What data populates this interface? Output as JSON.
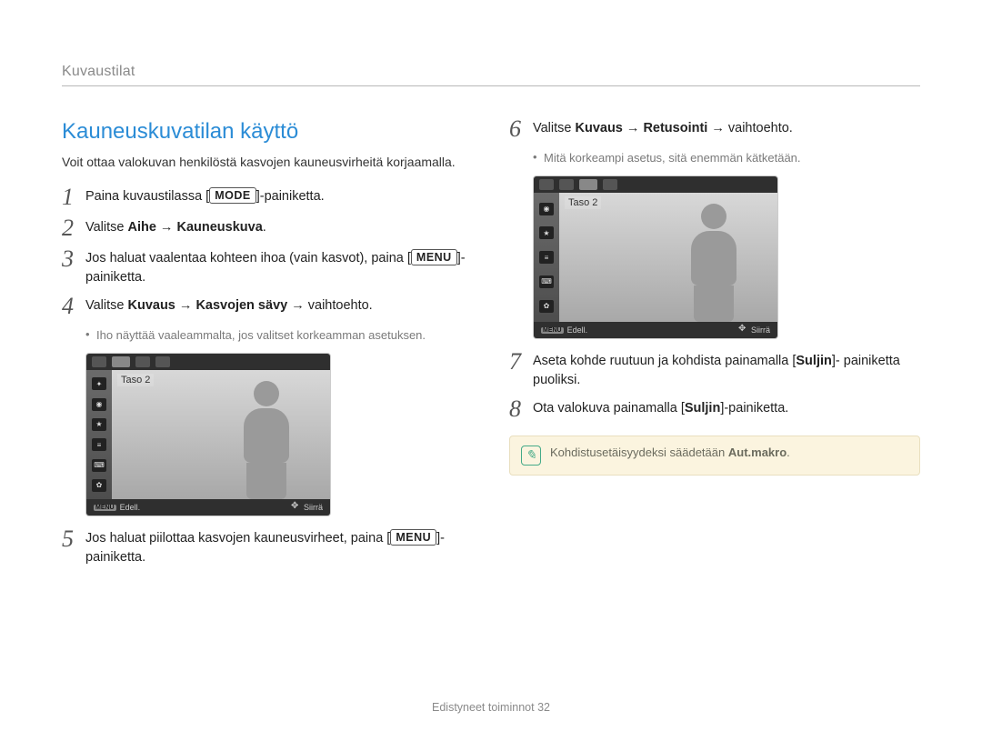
{
  "header": {
    "section": "Kuvaustilat"
  },
  "title": "Kauneuskuvatilan käyttö",
  "intro": "Voit ottaa valokuvan henkilöstä kasvojen kauneusvirheitä korjaamalla.",
  "buttons": {
    "mode": "MODE",
    "menu": "MENU"
  },
  "steps": {
    "s1_pre": "Paina kuvaustilassa [",
    "s1_post": "]-painiketta.",
    "s2_pre": "Valitse ",
    "s2_b1": "Aihe",
    "s2_arrow": " → ",
    "s2_b2": "Kauneuskuva",
    "s2_post": ".",
    "s3_pre": "Jos haluat vaalentaa kohteen ihoa (vain kasvot), paina [",
    "s3_post": "]-painiketta.",
    "s4_pre": "Valitse ",
    "s4_b1": "Kuvaus",
    "s4_mid1": " → ",
    "s4_b2": "Kasvojen sävy",
    "s4_mid2": " → vaihtoehto.",
    "s4_sub": "Iho näyttää vaaleammalta, jos valitset korkeamman asetuksen.",
    "s5_pre": "Jos haluat piilottaa kasvojen kauneusvirheet, paina [",
    "s5_post": "]-painiketta.",
    "s6_pre": "Valitse ",
    "s6_b1": "Kuvaus",
    "s6_mid1": " → ",
    "s6_b2": "Retusointi",
    "s6_mid2": " → vaihtoehto.",
    "s6_sub": "Mitä korkeampi asetus, sitä enemmän kätketään.",
    "s7_a": "Aseta kohde ruutuun ja kohdista painamalla [",
    "s7_b": "Suljin",
    "s7_c": "]- painiketta puoliksi.",
    "s8_a": "Ota valokuva painamalla [",
    "s8_b": "Suljin",
    "s8_c": "]-painiketta."
  },
  "screenshot": {
    "level_label": "Taso 2",
    "bottom_left_btn": "MENU",
    "bottom_left_txt": "Edell.",
    "bottom_right_txt": "Siirrä"
  },
  "note": {
    "pre": "Kohdistusetäisyydeksi säädetään ",
    "bold": "Aut.makro",
    "post": "."
  },
  "footer": {
    "section": "Edistyneet toiminnot",
    "page": "32"
  }
}
